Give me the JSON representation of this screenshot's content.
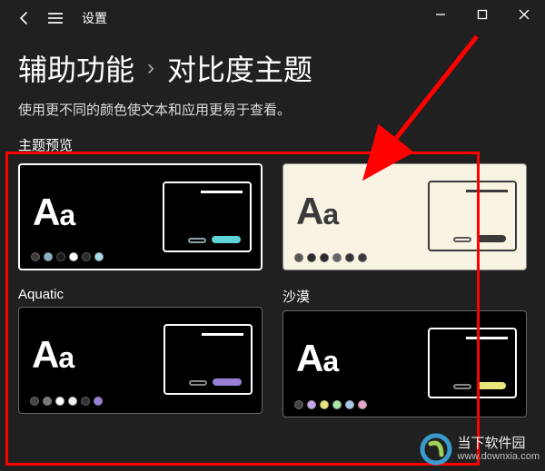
{
  "titlebar": {
    "settings": "设置"
  },
  "breadcrumb": {
    "parent": "辅助功能",
    "current": "对比度主题"
  },
  "subtitle": "使用更不同的颜色使文本和应用更易于查看。",
  "section_label": "主题预览",
  "themes": [
    {
      "name": "Aquatic",
      "selected": true,
      "bg": "#000000",
      "fg": "#ffffff",
      "border": "#8a8a8a",
      "palette": [
        "#3a3a3a",
        "#88b0c8",
        "#1a1a1a",
        "#ffffff",
        "#2a2a2a",
        "#a6dbe8"
      ],
      "accent": "#5fd4d8",
      "btn_border": "#8aa0aa"
    },
    {
      "name": "沙漠",
      "selected": false,
      "bg": "#f8f3e2",
      "fg": "#3a3a3a",
      "border": "#888888",
      "palette": [
        "#555555",
        "#2a2a2a",
        "#2a2a2a",
        "#666666",
        "#333333",
        "#3a3a3a"
      ],
      "accent": "#3a3a3a",
      "btn_border": "#5a5a5a"
    },
    {
      "name_hidden": true,
      "name": "",
      "selected": false,
      "bg": "#000000",
      "fg": "#ffffff",
      "border": "#666666",
      "palette": [
        "#444",
        "#777",
        "#ffffff",
        "#eee",
        "#333",
        "#9a7fd8"
      ],
      "accent": "#9a7fd8",
      "btn_border": "#888"
    },
    {
      "name_hidden": true,
      "name": "",
      "selected": false,
      "bg": "#000000",
      "fg": "#ffffff",
      "border": "#666666",
      "palette": [
        "#444",
        "#c9a6e8",
        "#e8e87a",
        "#a6e8a6",
        "#a6c9e8",
        "#e8a6c9"
      ],
      "accent": "#e8e87a",
      "btn_border": "#888"
    }
  ],
  "watermark": {
    "name": "当下软件园",
    "url": "www.downxia.com"
  }
}
